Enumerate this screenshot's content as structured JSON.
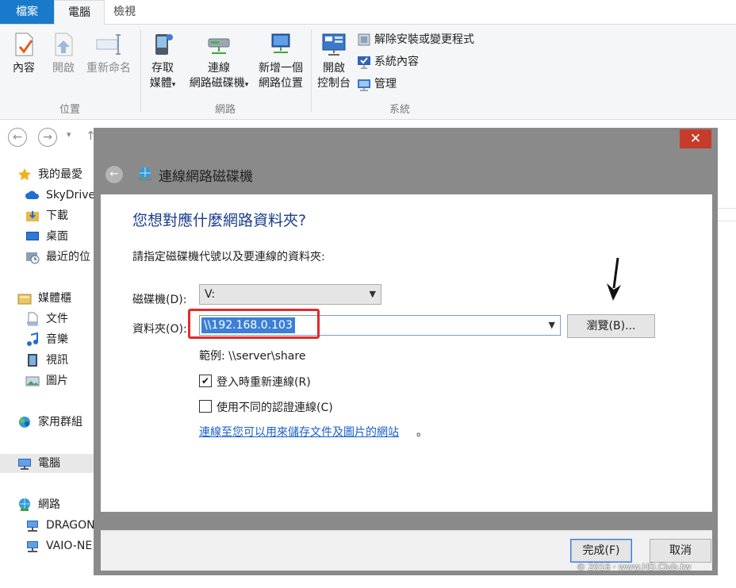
{
  "tabs": {
    "file": "檔案",
    "computer": "電腦",
    "view": "檢視"
  },
  "ribbon": {
    "location": {
      "label": "位置",
      "properties": "內容",
      "open": "開啟",
      "rename": "重新命名"
    },
    "network": {
      "label": "網路",
      "access_media_1": "存取",
      "access_media_2": "媒體",
      "map_drive_1": "連線",
      "map_drive_2": "網路磁碟機",
      "add_location_1": "新增一個",
      "add_location_2": "網路位置"
    },
    "system": {
      "label": "系統",
      "control_panel_1": "開啟",
      "control_panel_2": "控制台",
      "uninstall": "解除安裝或變更程式",
      "system_props": "系統內容",
      "manage": "管理"
    }
  },
  "address": {
    "back": "←",
    "forward": "→",
    "down": "▾",
    "up": "↑"
  },
  "nav": {
    "favorites": "我的最愛",
    "skydrive": "SkyDrive",
    "downloads": "下載",
    "desktop": "桌面",
    "recent": "最近的位",
    "libraries": "媒體櫃",
    "documents": "文件",
    "music": "音樂",
    "videos": "視訊",
    "pictures": "圖片",
    "homegroup": "家用群組",
    "computer": "電腦",
    "network": "網路",
    "dragon": "DRAGON",
    "vaio": "VAIO-NE"
  },
  "dialog": {
    "close": "✕",
    "back": "←",
    "title": "連線網路磁碟機",
    "heading": "您想對應什麼網路資料夾?",
    "instruction": "請指定磁碟機代號以及要連線的資料夾:",
    "drive_label": "磁碟機(D):",
    "drive_value": "V:",
    "folder_label": "資料夾(O):",
    "folder_value": "\\\\192.168.0.103",
    "browse": "瀏覽(B)...",
    "example": "範例: \\\\server\\share",
    "reconnect_label": "登入時重新連線(R)",
    "reconnect_checked": true,
    "diff_cred_label": "使用不同的認證連線(C)",
    "diff_cred_checked": false,
    "link": "連線至您可以用來儲存文件及圖片的網站",
    "link_suffix": "。",
    "finish": "完成(F)",
    "cancel": "取消"
  },
  "watermark": "© 2016 · www.HD.Club.tw",
  "colors": {
    "accent": "#1979ca",
    "link": "#1a5fcc",
    "heading": "#1a3e8c",
    "close": "#c73b2b",
    "highlight": "#e02b2b"
  }
}
